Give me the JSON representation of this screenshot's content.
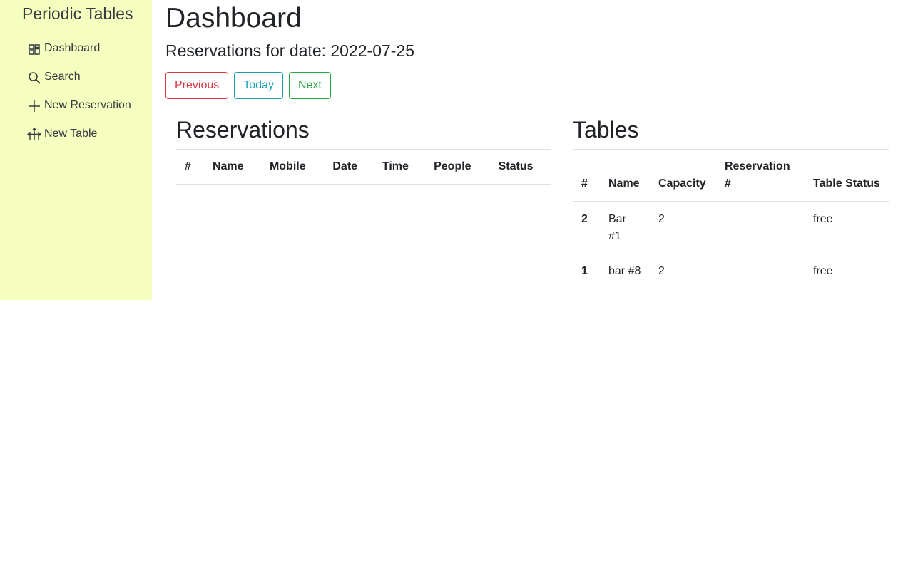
{
  "sidebar": {
    "brand": "Periodic Tables",
    "items": [
      {
        "label": "Dashboard",
        "icon": "dashboard-icon"
      },
      {
        "label": "Search",
        "icon": "search-icon"
      },
      {
        "label": "New Reservation",
        "icon": "plus-icon"
      },
      {
        "label": "New Table",
        "icon": "table-icon"
      }
    ]
  },
  "header": {
    "title": "Dashboard",
    "date_prefix": "Reservations for date: ",
    "date": "2022-07-25",
    "date_heading": "Reservations for date: 2022-07-25"
  },
  "buttons": {
    "previous": "Previous",
    "today": "Today",
    "next": "Next"
  },
  "reservations": {
    "title": "Reservations",
    "columns": [
      "#",
      "Name",
      "Mobile",
      "Date",
      "Time",
      "People",
      "Status"
    ],
    "rows": []
  },
  "tables": {
    "title": "Tables",
    "columns": [
      "#",
      "Name",
      "Capacity",
      "Reservation #",
      "Table Status"
    ],
    "rows": [
      {
        "id": "2",
        "name": "Bar #1",
        "capacity": "2",
        "reservation": "",
        "status": "free"
      },
      {
        "id": "1",
        "name": "bar #8",
        "capacity": "2",
        "reservation": "",
        "status": "free"
      }
    ]
  },
  "colors": {
    "sidebar_bg": "#f7ffc0",
    "previous": "#dc3545",
    "today": "#17a2b8",
    "next": "#28a745"
  }
}
